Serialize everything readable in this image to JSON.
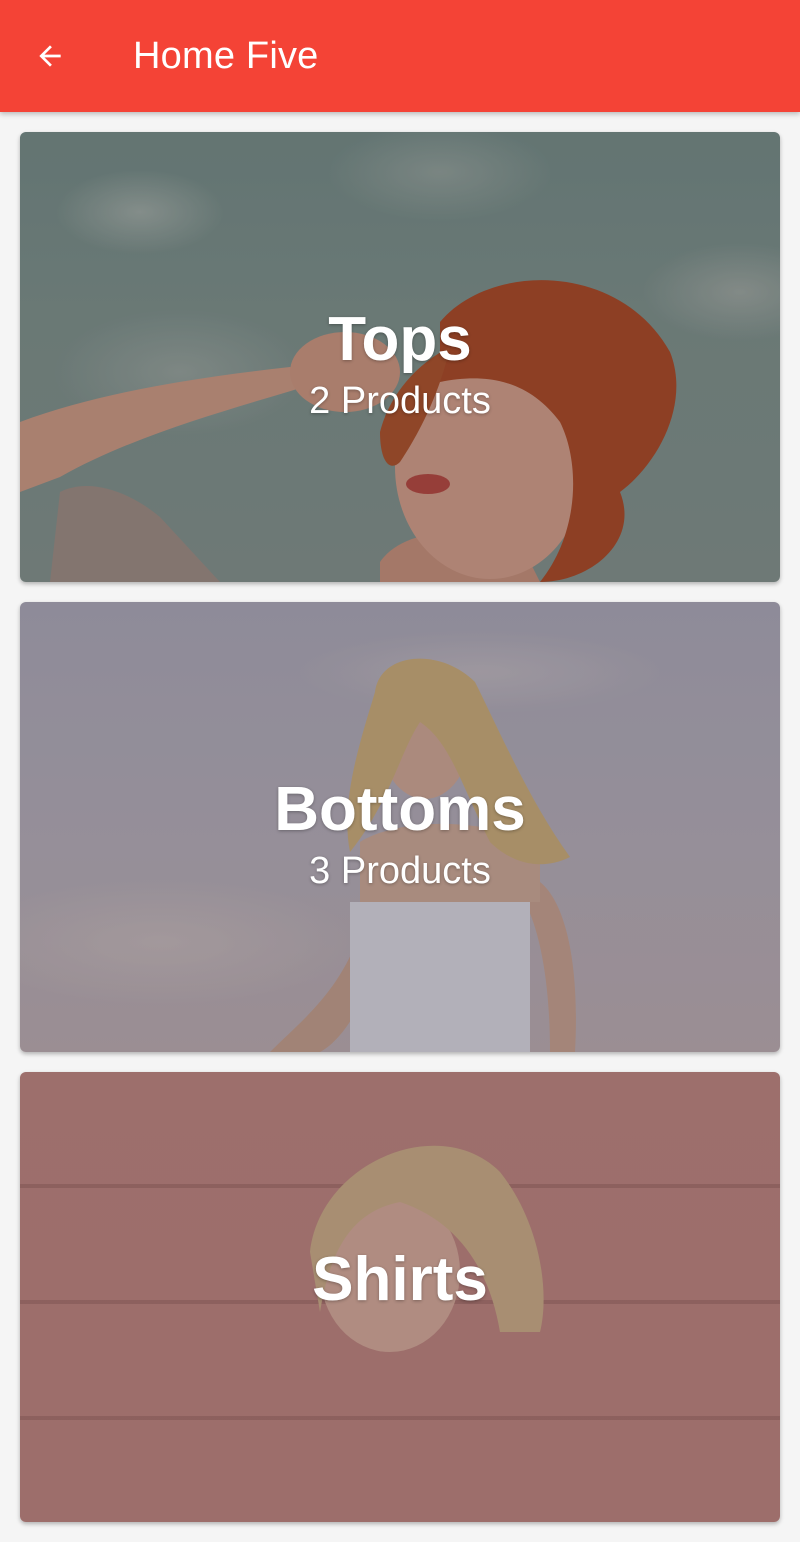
{
  "appbar": {
    "title": "Home Five",
    "color": "#f44336",
    "back_icon": "arrow-back-icon"
  },
  "categories": [
    {
      "name": "Tops",
      "count": "2 Products"
    },
    {
      "name": "Bottoms",
      "count": "3 Products"
    },
    {
      "name": "Shirts",
      "count": ""
    }
  ]
}
